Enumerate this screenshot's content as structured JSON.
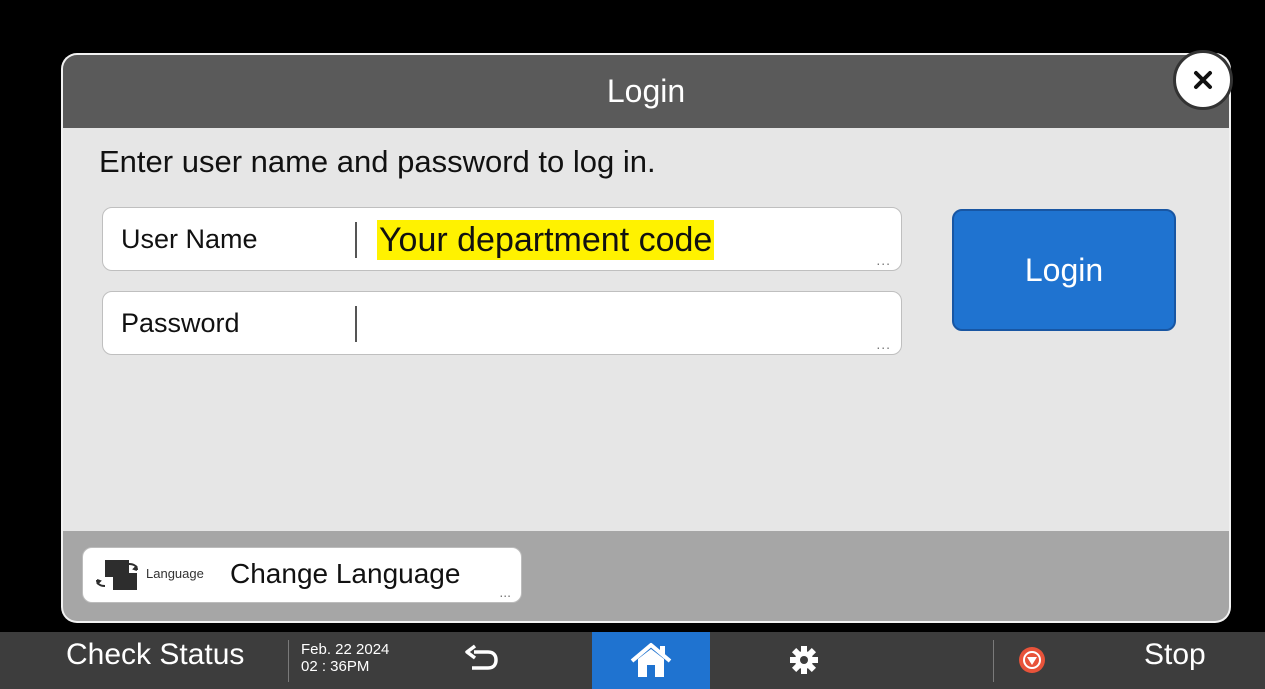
{
  "dialog": {
    "title": "Login",
    "instruction": "Enter user name and password to log in.",
    "fields": [
      {
        "label": "User Name",
        "value": "Your department code",
        "dots": "..."
      },
      {
        "label": "Password",
        "value": "",
        "dots": "..."
      }
    ],
    "login_button": "Login",
    "close_icon": "close-icon",
    "footer": {
      "language_small": "Language",
      "change_language": "Change Language",
      "dots": "..."
    }
  },
  "taskbar": {
    "check_status": "Check Status",
    "date": "Feb. 22 2024",
    "time": "02 : 36PM",
    "stop": "Stop",
    "icons": [
      "back-icon",
      "home-icon",
      "gear-icon",
      "stop-icon"
    ]
  },
  "colors": {
    "accent_blue": "#1f73d0",
    "header_gray": "#5a5a5a",
    "highlight": "#fff200",
    "stop_red": "#e8533a"
  }
}
